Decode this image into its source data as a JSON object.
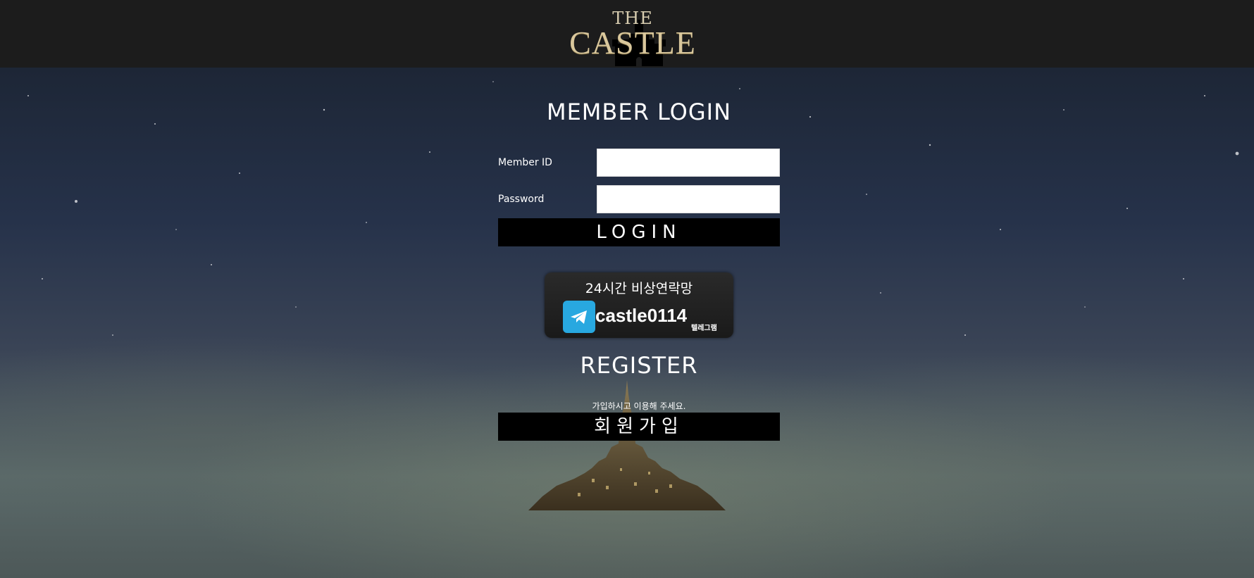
{
  "header": {
    "logo_top": "THE",
    "logo_name": "CASTLE"
  },
  "login": {
    "title": "MEMBER LOGIN",
    "id_label": "Member ID",
    "id_value": "",
    "password_label": "Password",
    "password_value": "",
    "button_label": "LOGIN"
  },
  "contact": {
    "title": "24시간 비상연락망",
    "handle": "castle0114",
    "platform": "텔레그램",
    "icon": "telegram-icon",
    "icon_color": "#28a8e0"
  },
  "register": {
    "title": "REGISTER",
    "note": "가입하시고 이용해 주세요.",
    "button_label": "회원가입"
  }
}
